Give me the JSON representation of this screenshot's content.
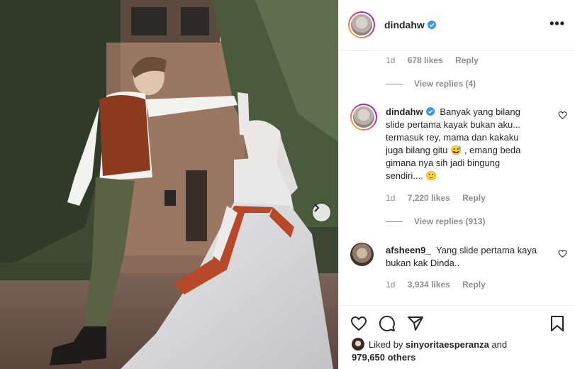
{
  "post": {
    "author": "dindahw",
    "more_icon": "more-horizontal-icon"
  },
  "thread": {
    "reply_meta": {
      "time": "1d",
      "likes": "678 likes",
      "reply": "Reply"
    },
    "view_replies_1": "View replies (4)"
  },
  "comments": [
    {
      "username": "dindahw",
      "verified": true,
      "text": "Banyak yang bilang slide pertama kayak bukan aku... termasuk rey, mama dan kakaku juga bilang gitu 😅 , emang beda gimana nya sih jadi bingung sendiri.... 🙂",
      "time": "1d",
      "likes": "7,220 likes",
      "reply": "Reply",
      "view_replies": "View replies (913)"
    },
    {
      "username": "afsheen9_",
      "verified": false,
      "text": "Yang slide pertama kaya bukan kak Dinda..",
      "time": "1d",
      "likes": "3,934 likes",
      "reply": "Reply"
    }
  ],
  "footer": {
    "liked_prefix": "Liked by",
    "liked_user": "sinyoritaesperanza",
    "liked_and": "and",
    "liked_count": "979,650 others"
  },
  "colors": {
    "accent_blue": "#3897f0",
    "muted": "#8e8e8e",
    "text": "#262626"
  }
}
